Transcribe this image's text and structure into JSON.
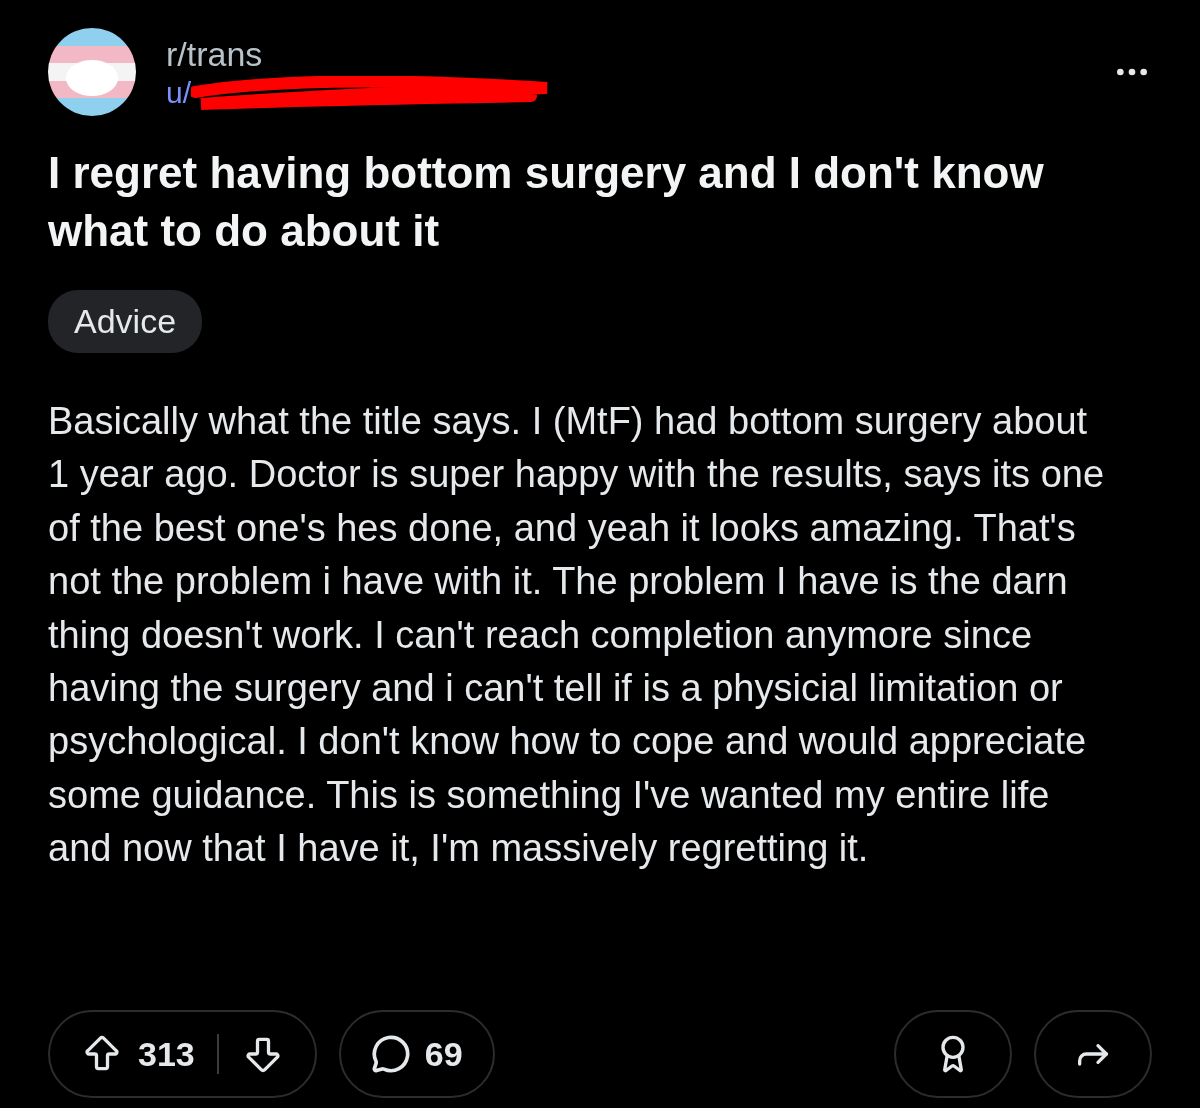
{
  "post": {
    "subreddit": "r/trans",
    "author": "u/",
    "author_redacted": true,
    "title": "I regret having bottom surgery and I don't know what to do about it",
    "flair": "Advice",
    "body": "Basically what the title says. I (MtF) had bottom surgery about 1 year ago. Doctor is super happy with the results, says its one of the best one's hes done, and yeah it looks amazing. That's not the problem i have with it. The problem I have is the darn thing doesn't work. I can't reach completion anymore since having the surgery and i can't tell if is a physicial limitation or psychological. I don't know how to cope and would appreciate some guidance. This is something I've wanted my entire life and now that I have it, I'm massively regretting it."
  },
  "actions": {
    "votes": "313",
    "comments": "69"
  }
}
